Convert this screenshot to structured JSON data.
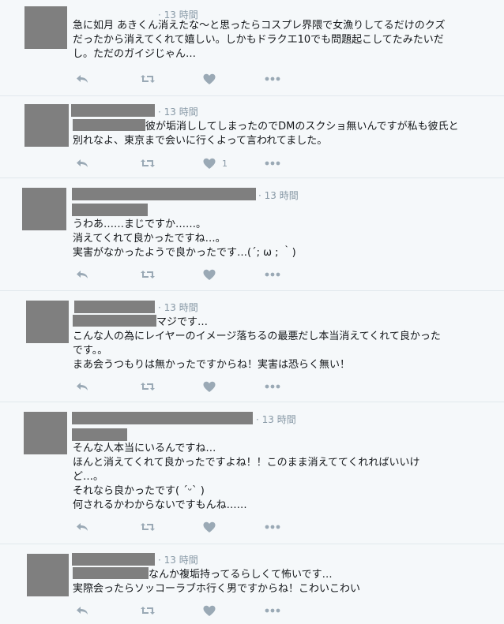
{
  "tweets": [
    {
      "time": "· 13 時間",
      "lines": [
        "急に如月 あきくん消えたな〜と思ったらコスプレ界隈で女漁りしてるだけのクズ",
        "だったから消えてくれて嬉しい。しかもドラクエ10でも問題起こしてたみたいだ",
        "し。ただのガイジじゃん…"
      ],
      "like_count": ""
    },
    {
      "time": "· 13 時間",
      "lines": [
        "彼が垢消ししてしまったのでDMのスクショ無いんですが私も彼氏と",
        "別れなよ、東京まで会いに行くよって言われてました。"
      ],
      "like_count": "1"
    },
    {
      "time": "· 13 時間",
      "lines": [
        "うわあ……まじですか……。",
        "消えてくれて良かったですね…。",
        "実害がなかったようで良かったです…(´; ω ; ｀)"
      ],
      "like_count": ""
    },
    {
      "time": "· 13 時間",
      "lines": [
        "マジです…",
        "こんな人の為にレイヤーのイメージ落ちるの最悪だし本当消えてくれて良かった",
        "です。。",
        "まあ会うつもりは無かったですからね！実害は恐らく無い！"
      ],
      "like_count": ""
    },
    {
      "time": "· 13 時間",
      "lines": [
        "そんな人本当にいるんですね…",
        "ほんと消えてくれて良かったですよね！！このまま消えててくれればいいけ",
        "ど…。",
        "それなら良かったです( ´ᵕ` )",
        "何されるかわからないですもんね……"
      ],
      "like_count": ""
    },
    {
      "time": "· 13 時間",
      "lines": [
        "なんか複垢持ってるらしくて怖いです…",
        "実際会ったらソッコーラブホ行く男ですからね！こわいこわい"
      ],
      "like_count": ""
    }
  ],
  "icons": {
    "reply": "reply-icon",
    "retweet": "retweet-icon",
    "like": "heart-icon",
    "more": "more-icon"
  },
  "colors": {
    "background": "#f5f8fa",
    "action_icon": "#9aa9b5",
    "meta_text": "#8899a6",
    "redaction": "#7f7f7f"
  }
}
